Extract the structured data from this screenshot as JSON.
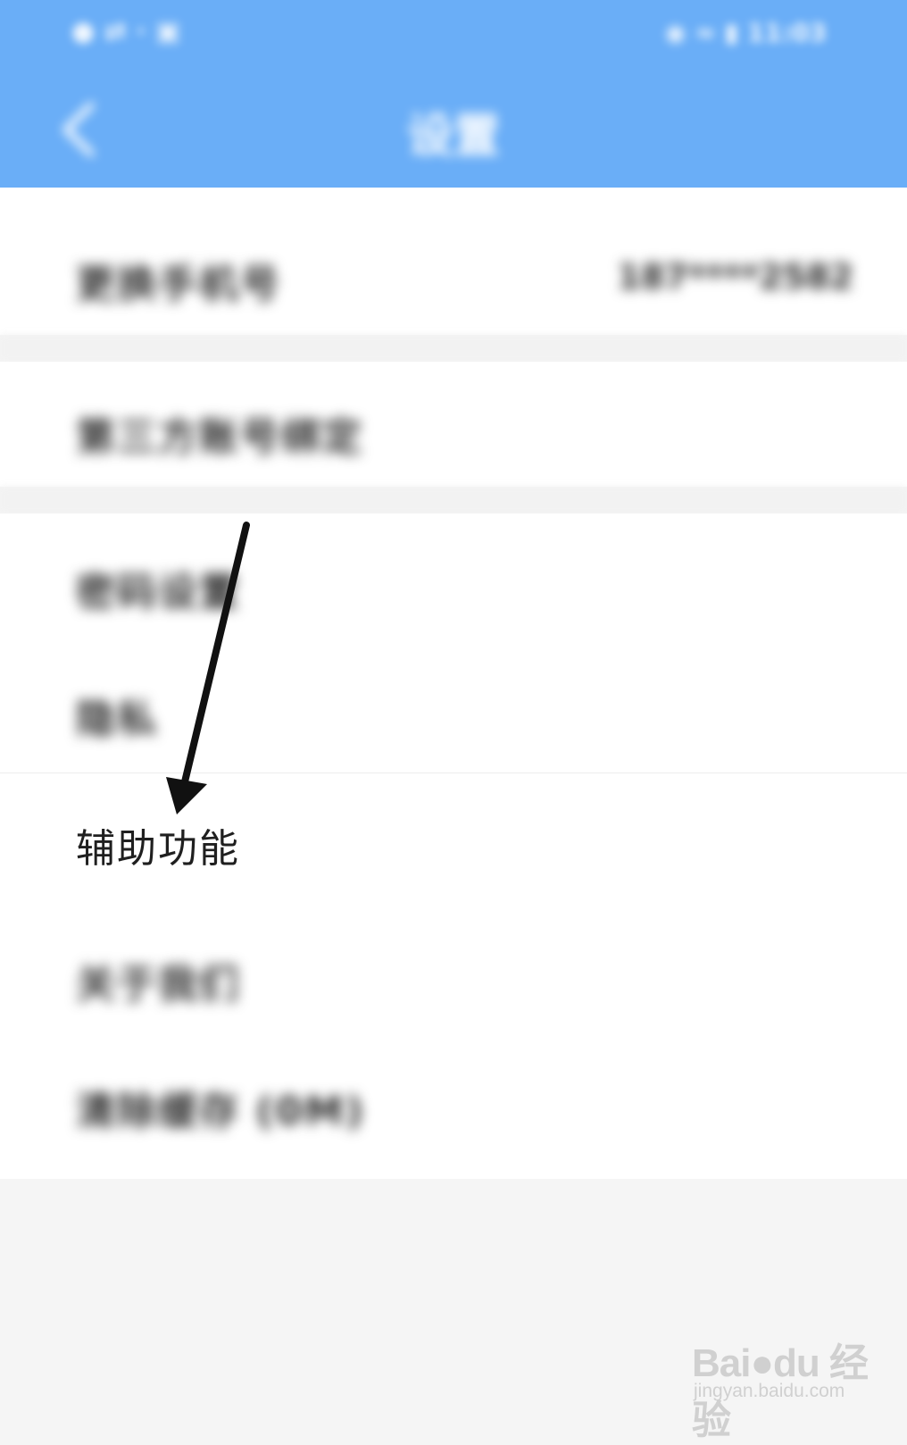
{
  "status_bar": {
    "left_text": "● ⇄ · ▣",
    "right_text": "◉ ≈ ▮ 11:03"
  },
  "header": {
    "title": "设置",
    "back_icon": "chevron-left-icon"
  },
  "settings": {
    "items": [
      {
        "label": "更换手机号",
        "value": "187****2582"
      },
      {
        "label": "第三方账号绑定"
      },
      {
        "label": "密码设置"
      },
      {
        "label": "隐私"
      },
      {
        "label": "辅助功能"
      },
      {
        "label": "关于我们"
      },
      {
        "label": "清除缓存 (0M)"
      }
    ]
  },
  "annotation": {
    "arrow_color": "#111111"
  },
  "watermark": {
    "logo": "Bai●du 经验",
    "url": "jingyan.baidu.com"
  },
  "colors": {
    "header_bg": "#6aaef7",
    "page_bg": "#f5f5f5",
    "row_bg": "#ffffff"
  }
}
